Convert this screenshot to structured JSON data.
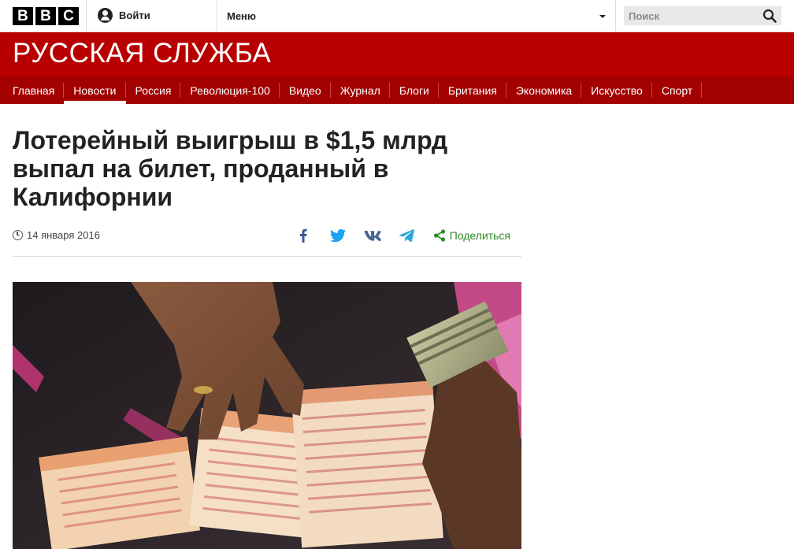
{
  "topbar": {
    "logo_letters": [
      "B",
      "B",
      "C"
    ],
    "signin_label": "Войти",
    "menu_label": "Меню",
    "search_placeholder": "Поиск"
  },
  "masthead": {
    "title": "РУССКАЯ СЛУЖБА"
  },
  "nav": {
    "items": [
      {
        "label": "Главная",
        "active": false
      },
      {
        "label": "Новости",
        "active": true
      },
      {
        "label": "Россия",
        "active": false
      },
      {
        "label": "Революция-100",
        "active": false
      },
      {
        "label": "Видео",
        "active": false
      },
      {
        "label": "Журнал",
        "active": false
      },
      {
        "label": "Блоги",
        "active": false
      },
      {
        "label": "Британия",
        "active": false
      },
      {
        "label": "Экономика",
        "active": false
      },
      {
        "label": "Искусство",
        "active": false
      },
      {
        "label": "Спорт",
        "active": false
      }
    ]
  },
  "article": {
    "headline": "Лотерейный выигрыш в $1,5 млрд выпал на билет, проданный в Калифорнии",
    "date": "14 января 2016",
    "share_label": "Поделиться"
  },
  "colors": {
    "brand_red": "#b80000",
    "nav_red": "#a30000",
    "share_green": "#2e8b28",
    "facebook": "#3b5998",
    "twitter": "#1da1f2",
    "vk": "#45668e",
    "telegram": "#2ca5e0"
  },
  "icons": [
    "signin-icon",
    "search-icon",
    "clock-icon",
    "facebook-icon",
    "twitter-icon",
    "vk-icon",
    "telegram-icon",
    "share-icon"
  ]
}
